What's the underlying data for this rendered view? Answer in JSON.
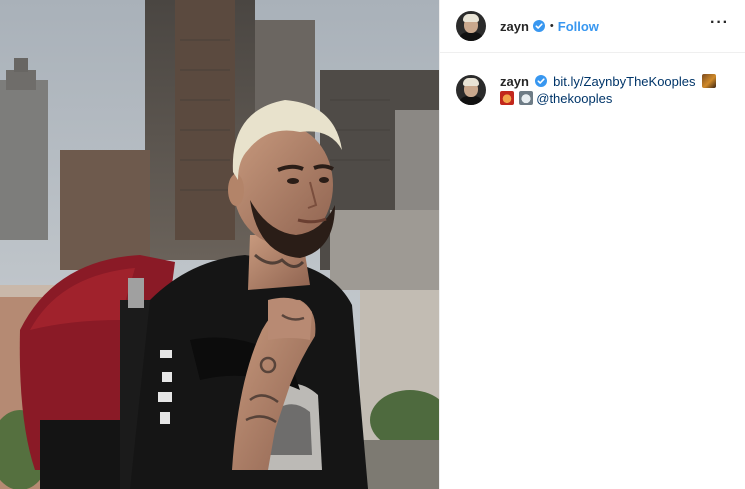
{
  "post": {
    "photo": {
      "name": "post-photo"
    },
    "header": {
      "username": "zayn",
      "separator": "•",
      "follow_label": "Follow",
      "more_label": "···"
    },
    "caption": {
      "username": "zayn",
      "link_text": "bit.ly/ZaynbyTheKooples",
      "mention": "@thekooples"
    },
    "colors": {
      "link": "#003569",
      "follow": "#3897f0",
      "verified": "#3897f0"
    },
    "icons": [
      "verified-badge-icon",
      "more-options-icon"
    ]
  }
}
